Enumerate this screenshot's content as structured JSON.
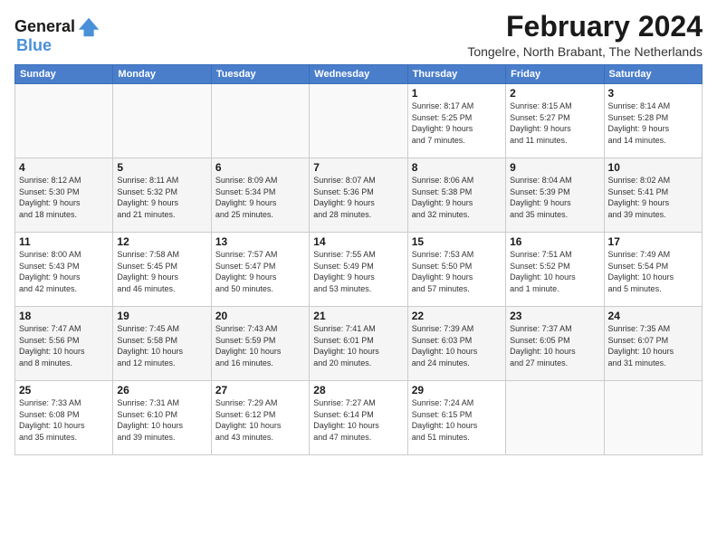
{
  "header": {
    "logo_line1": "General",
    "logo_line2": "Blue",
    "month_title": "February 2024",
    "location": "Tongelre, North Brabant, The Netherlands"
  },
  "days_of_week": [
    "Sunday",
    "Monday",
    "Tuesday",
    "Wednesday",
    "Thursday",
    "Friday",
    "Saturday"
  ],
  "weeks": [
    [
      {
        "day": "",
        "info": ""
      },
      {
        "day": "",
        "info": ""
      },
      {
        "day": "",
        "info": ""
      },
      {
        "day": "",
        "info": ""
      },
      {
        "day": "1",
        "info": "Sunrise: 8:17 AM\nSunset: 5:25 PM\nDaylight: 9 hours\nand 7 minutes."
      },
      {
        "day": "2",
        "info": "Sunrise: 8:15 AM\nSunset: 5:27 PM\nDaylight: 9 hours\nand 11 minutes."
      },
      {
        "day": "3",
        "info": "Sunrise: 8:14 AM\nSunset: 5:28 PM\nDaylight: 9 hours\nand 14 minutes."
      }
    ],
    [
      {
        "day": "4",
        "info": "Sunrise: 8:12 AM\nSunset: 5:30 PM\nDaylight: 9 hours\nand 18 minutes."
      },
      {
        "day": "5",
        "info": "Sunrise: 8:11 AM\nSunset: 5:32 PM\nDaylight: 9 hours\nand 21 minutes."
      },
      {
        "day": "6",
        "info": "Sunrise: 8:09 AM\nSunset: 5:34 PM\nDaylight: 9 hours\nand 25 minutes."
      },
      {
        "day": "7",
        "info": "Sunrise: 8:07 AM\nSunset: 5:36 PM\nDaylight: 9 hours\nand 28 minutes."
      },
      {
        "day": "8",
        "info": "Sunrise: 8:06 AM\nSunset: 5:38 PM\nDaylight: 9 hours\nand 32 minutes."
      },
      {
        "day": "9",
        "info": "Sunrise: 8:04 AM\nSunset: 5:39 PM\nDaylight: 9 hours\nand 35 minutes."
      },
      {
        "day": "10",
        "info": "Sunrise: 8:02 AM\nSunset: 5:41 PM\nDaylight: 9 hours\nand 39 minutes."
      }
    ],
    [
      {
        "day": "11",
        "info": "Sunrise: 8:00 AM\nSunset: 5:43 PM\nDaylight: 9 hours\nand 42 minutes."
      },
      {
        "day": "12",
        "info": "Sunrise: 7:58 AM\nSunset: 5:45 PM\nDaylight: 9 hours\nand 46 minutes."
      },
      {
        "day": "13",
        "info": "Sunrise: 7:57 AM\nSunset: 5:47 PM\nDaylight: 9 hours\nand 50 minutes."
      },
      {
        "day": "14",
        "info": "Sunrise: 7:55 AM\nSunset: 5:49 PM\nDaylight: 9 hours\nand 53 minutes."
      },
      {
        "day": "15",
        "info": "Sunrise: 7:53 AM\nSunset: 5:50 PM\nDaylight: 9 hours\nand 57 minutes."
      },
      {
        "day": "16",
        "info": "Sunrise: 7:51 AM\nSunset: 5:52 PM\nDaylight: 10 hours\nand 1 minute."
      },
      {
        "day": "17",
        "info": "Sunrise: 7:49 AM\nSunset: 5:54 PM\nDaylight: 10 hours\nand 5 minutes."
      }
    ],
    [
      {
        "day": "18",
        "info": "Sunrise: 7:47 AM\nSunset: 5:56 PM\nDaylight: 10 hours\nand 8 minutes."
      },
      {
        "day": "19",
        "info": "Sunrise: 7:45 AM\nSunset: 5:58 PM\nDaylight: 10 hours\nand 12 minutes."
      },
      {
        "day": "20",
        "info": "Sunrise: 7:43 AM\nSunset: 5:59 PM\nDaylight: 10 hours\nand 16 minutes."
      },
      {
        "day": "21",
        "info": "Sunrise: 7:41 AM\nSunset: 6:01 PM\nDaylight: 10 hours\nand 20 minutes."
      },
      {
        "day": "22",
        "info": "Sunrise: 7:39 AM\nSunset: 6:03 PM\nDaylight: 10 hours\nand 24 minutes."
      },
      {
        "day": "23",
        "info": "Sunrise: 7:37 AM\nSunset: 6:05 PM\nDaylight: 10 hours\nand 27 minutes."
      },
      {
        "day": "24",
        "info": "Sunrise: 7:35 AM\nSunset: 6:07 PM\nDaylight: 10 hours\nand 31 minutes."
      }
    ],
    [
      {
        "day": "25",
        "info": "Sunrise: 7:33 AM\nSunset: 6:08 PM\nDaylight: 10 hours\nand 35 minutes."
      },
      {
        "day": "26",
        "info": "Sunrise: 7:31 AM\nSunset: 6:10 PM\nDaylight: 10 hours\nand 39 minutes."
      },
      {
        "day": "27",
        "info": "Sunrise: 7:29 AM\nSunset: 6:12 PM\nDaylight: 10 hours\nand 43 minutes."
      },
      {
        "day": "28",
        "info": "Sunrise: 7:27 AM\nSunset: 6:14 PM\nDaylight: 10 hours\nand 47 minutes."
      },
      {
        "day": "29",
        "info": "Sunrise: 7:24 AM\nSunset: 6:15 PM\nDaylight: 10 hours\nand 51 minutes."
      },
      {
        "day": "",
        "info": ""
      },
      {
        "day": "",
        "info": ""
      }
    ]
  ]
}
